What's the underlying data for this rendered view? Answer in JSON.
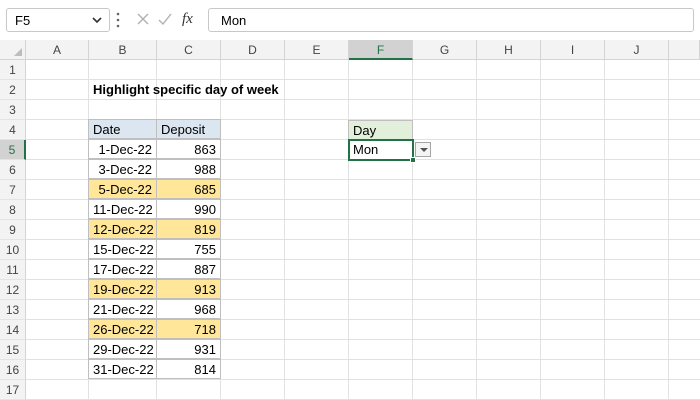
{
  "formula_bar": {
    "name_box": "F5",
    "formula": "Mon",
    "icons": [
      "chevron-down-icon",
      "more-vertical-icon",
      "cancel-icon",
      "enter-icon",
      "fx-icon"
    ]
  },
  "columns": [
    "A",
    "B",
    "C",
    "D",
    "E",
    "F",
    "G",
    "H",
    "I",
    "J"
  ],
  "rows": [
    "1",
    "2",
    "3",
    "4",
    "5",
    "6",
    "7",
    "8",
    "9",
    "10",
    "11",
    "12",
    "13",
    "14",
    "15",
    "16",
    "17"
  ],
  "title": "Highlight specific day of week",
  "table": {
    "headers": {
      "date": "Date",
      "deposit": "Deposit"
    },
    "rows": [
      {
        "date": "1-Dec-22",
        "deposit": "863"
      },
      {
        "date": "3-Dec-22",
        "deposit": "988"
      },
      {
        "date": "5-Dec-22",
        "deposit": "685"
      },
      {
        "date": "11-Dec-22",
        "deposit": "990"
      },
      {
        "date": "12-Dec-22",
        "deposit": "819"
      },
      {
        "date": "15-Dec-22",
        "deposit": "755"
      },
      {
        "date": "17-Dec-22",
        "deposit": "887"
      },
      {
        "date": "19-Dec-22",
        "deposit": "913"
      },
      {
        "date": "21-Dec-22",
        "deposit": "968"
      },
      {
        "date": "26-Dec-22",
        "deposit": "718"
      },
      {
        "date": "29-Dec-22",
        "deposit": "931"
      },
      {
        "date": "31-Dec-22",
        "deposit": "814"
      }
    ],
    "highlight_color": "#ffe699",
    "header_color": "#dce6f1"
  },
  "day_input": {
    "label": "Day",
    "value": "Mon",
    "label_color": "#e2efda"
  },
  "accent_color": "#217346"
}
